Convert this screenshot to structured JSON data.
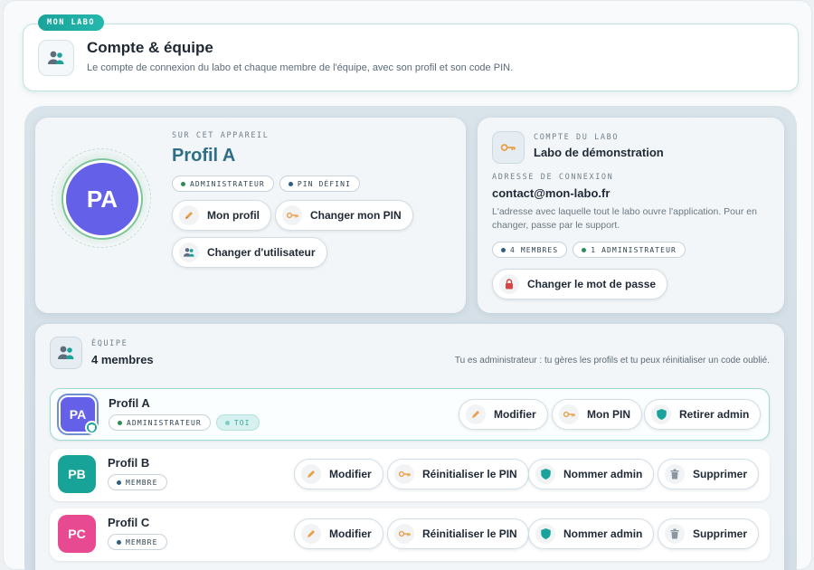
{
  "tag": "MON LABO",
  "header": {
    "title": "Compte & équipe",
    "subtitle": "Le compte de connexion du labo et chaque membre de l'équipe, avec son profil et son code PIN."
  },
  "current_profile": {
    "eyebrow": "SUR CET APPAREIL",
    "name": "Profil A",
    "initials": "PA",
    "badges": [
      "ADMINISTRATEUR",
      "PIN DÉFINI"
    ],
    "buttons": {
      "my_profile": "Mon profil",
      "change_pin": "Changer mon PIN",
      "switch_user": "Changer d'utilisateur"
    }
  },
  "lab_account": {
    "eyebrow": "COMPTE DU LABO",
    "name": "Labo de démonstration",
    "login_label": "ADRESSE DE CONNEXION",
    "email": "contact@mon-labo.fr",
    "note": "L'adresse avec laquelle tout le labo ouvre l'application. Pour en changer, passe par le support.",
    "badges": [
      "4 MEMBRES",
      "1 ADMINISTRATEUR"
    ],
    "change_password": "Changer le mot de passe"
  },
  "team": {
    "eyebrow": "ÉQUIPE",
    "count_label": "4 membres",
    "admin_note": "Tu es administrateur : tu gères les profils et tu peux réinitialiser un code oublié.",
    "members": [
      {
        "initials": "PA",
        "name": "Profil A",
        "role": "ADMINISTRATEUR",
        "you": "TOI",
        "color": "#6461e8",
        "actions": [
          "Modifier",
          "Mon PIN",
          "Retirer admin"
        ]
      },
      {
        "initials": "PB",
        "name": "Profil B",
        "role": "MEMBRE",
        "color": "#17a398",
        "actions": [
          "Modifier",
          "Réinitialiser le PIN",
          "Nommer admin",
          "Supprimer"
        ]
      },
      {
        "initials": "PC",
        "name": "Profil C",
        "role": "MEMBRE",
        "color": "#e84a92",
        "actions": [
          "Modifier",
          "Réinitialiser le PIN",
          "Nommer admin",
          "Supprimer"
        ]
      }
    ]
  },
  "colors": {
    "accent_teal": "#1aa39b",
    "profile_title": "#2f6f86",
    "admin_dot": "#2e8b57",
    "info_dot": "#2d5f86"
  }
}
